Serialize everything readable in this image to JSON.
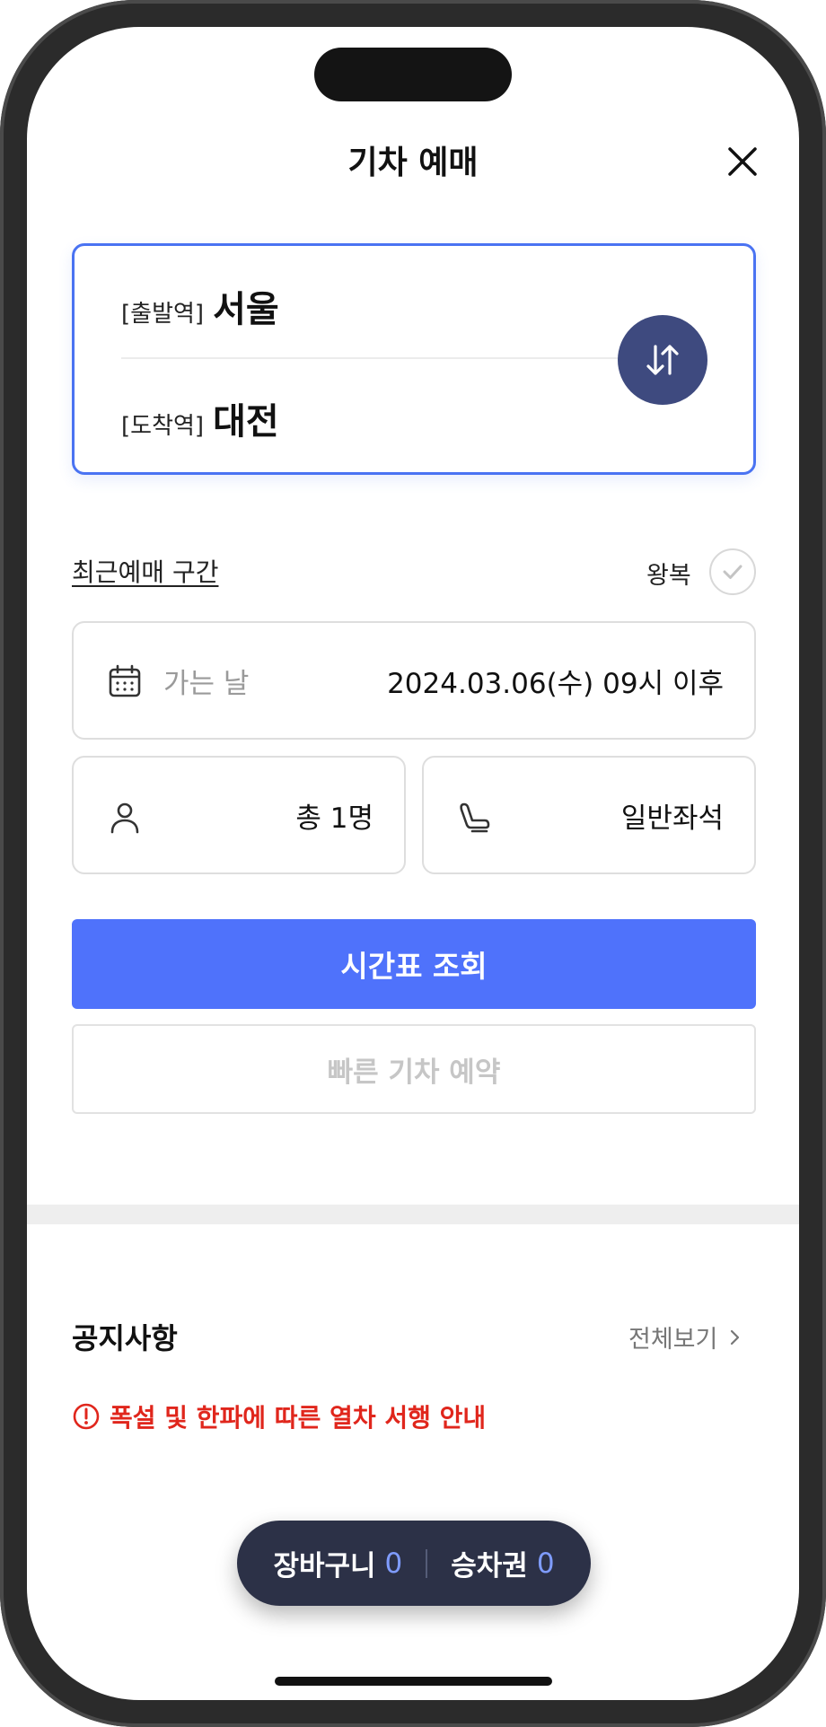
{
  "header": {
    "title": "기차 예매"
  },
  "stations": {
    "departure_tag": "[출발역]",
    "departure_name": "서울",
    "arrival_tag": "[도착역]",
    "arrival_name": "대전"
  },
  "options": {
    "recent_label": "최근예매 구간",
    "round_trip_label": "왕복",
    "round_trip_checked": false,
    "date_label": "가는 날",
    "date_value": "2024.03.06(수) 09시 이후",
    "passenger_value": "총 1명",
    "seat_value": "일반좌석"
  },
  "actions": {
    "search_label": "시간표 조회",
    "quick_label": "빠른 기차 예약"
  },
  "notice": {
    "title": "공지사항",
    "more_label": "전체보기",
    "items": [
      {
        "text": "폭설 및 한파에 따른 열차 서행 안내"
      }
    ]
  },
  "cart": {
    "basket_label": "장바구니",
    "basket_count": "0",
    "ticket_label": "승차권",
    "ticket_count": "0"
  },
  "colors": {
    "accent": "#4f72fb",
    "card_border": "#4a73f2",
    "swap_button": "#3e4a7f",
    "notice_red": "#e0261c",
    "pill_bg": "#2c3147"
  },
  "icons": {
    "close": "close-icon",
    "swap": "swap-arrows-icon",
    "check": "check-icon",
    "calendar": "calendar-icon",
    "person": "person-icon",
    "seat": "seat-icon",
    "chevron": "chevron-right-icon",
    "alert": "alert-circle-icon"
  }
}
